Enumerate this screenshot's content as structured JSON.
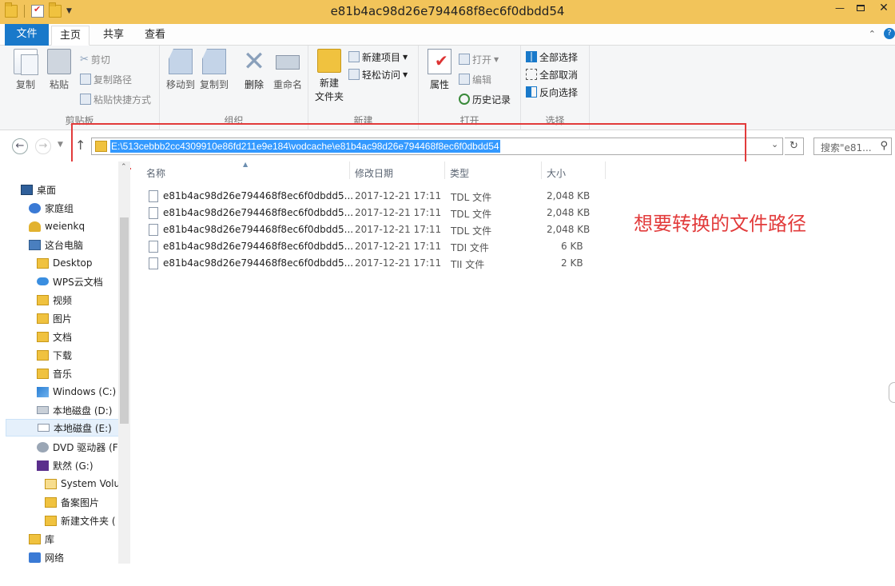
{
  "window": {
    "title": "e81b4ac98d26e794468f8ec6f0dbdd54"
  },
  "tabs": {
    "file": "文件",
    "home": "主页",
    "share": "共享",
    "view": "查看"
  },
  "ribbon": {
    "clipboard": {
      "label": "剪贴板",
      "copy": "复制",
      "paste": "粘贴",
      "cut": "剪切",
      "copy_path": "复制路径",
      "paste_shortcut": "粘贴快捷方式"
    },
    "organize": {
      "label": "组织",
      "move_to": "移动到",
      "copy_to": "复制到",
      "delete": "删除",
      "rename": "重命名"
    },
    "new": {
      "label": "新建",
      "new_folder_line1": "新建",
      "new_folder_line2": "文件夹",
      "new_item": "新建项目",
      "easy_access": "轻松访问"
    },
    "open": {
      "label": "打开",
      "properties": "属性",
      "open": "打开",
      "edit": "编辑",
      "history": "历史记录"
    },
    "select": {
      "label": "选择",
      "select_all": "全部选择",
      "select_none": "全部取消",
      "invert": "反向选择"
    }
  },
  "address": {
    "path": "E:\\513cebbb2cc4309910e86fd211e9e184\\vodcache\\e81b4ac98d26e794468f8ec6f0dbdd54"
  },
  "search": {
    "placeholder": "搜索\"e81..."
  },
  "sidebar": {
    "items": [
      {
        "label": "桌面"
      },
      {
        "label": "家庭组"
      },
      {
        "label": "weienkq"
      },
      {
        "label": "这台电脑"
      },
      {
        "label": "Desktop"
      },
      {
        "label": "WPS云文档"
      },
      {
        "label": "视频"
      },
      {
        "label": "图片"
      },
      {
        "label": "文档"
      },
      {
        "label": "下载"
      },
      {
        "label": "音乐"
      },
      {
        "label": "Windows (C:)"
      },
      {
        "label": "本地磁盘 (D:)"
      },
      {
        "label": "本地磁盘 (E:)"
      },
      {
        "label": "DVD 驱动器 (F"
      },
      {
        "label": "默然 (G:)"
      },
      {
        "label": "System Volu"
      },
      {
        "label": "备案图片"
      },
      {
        "label": "新建文件夹 ("
      },
      {
        "label": "库"
      },
      {
        "label": "网络"
      }
    ]
  },
  "columns": {
    "name": "名称",
    "date": "修改日期",
    "type": "类型",
    "size": "大小"
  },
  "files": [
    {
      "name": "e81b4ac98d26e794468f8ec6f0dbdd5...",
      "date": "2017-12-21 17:11",
      "type": "TDL 文件",
      "size": "2,048 KB"
    },
    {
      "name": "e81b4ac98d26e794468f8ec6f0dbdd5...",
      "date": "2017-12-21 17:11",
      "type": "TDL 文件",
      "size": "2,048 KB"
    },
    {
      "name": "e81b4ac98d26e794468f8ec6f0dbdd5...",
      "date": "2017-12-21 17:11",
      "type": "TDL 文件",
      "size": "2,048 KB"
    },
    {
      "name": "e81b4ac98d26e794468f8ec6f0dbdd5...",
      "date": "2017-12-21 17:11",
      "type": "TDI 文件",
      "size": "6 KB"
    },
    {
      "name": "e81b4ac98d26e794468f8ec6f0dbdd5...",
      "date": "2017-12-21 17:11",
      "type": "TII 文件",
      "size": "2 KB"
    }
  ],
  "annotation": {
    "text": "想要转换的文件路径"
  },
  "colors": {
    "accent": "#1979ca",
    "title_bar": "#f2c45a",
    "highlight": "#e23b3b",
    "selection": "#3399ff"
  }
}
